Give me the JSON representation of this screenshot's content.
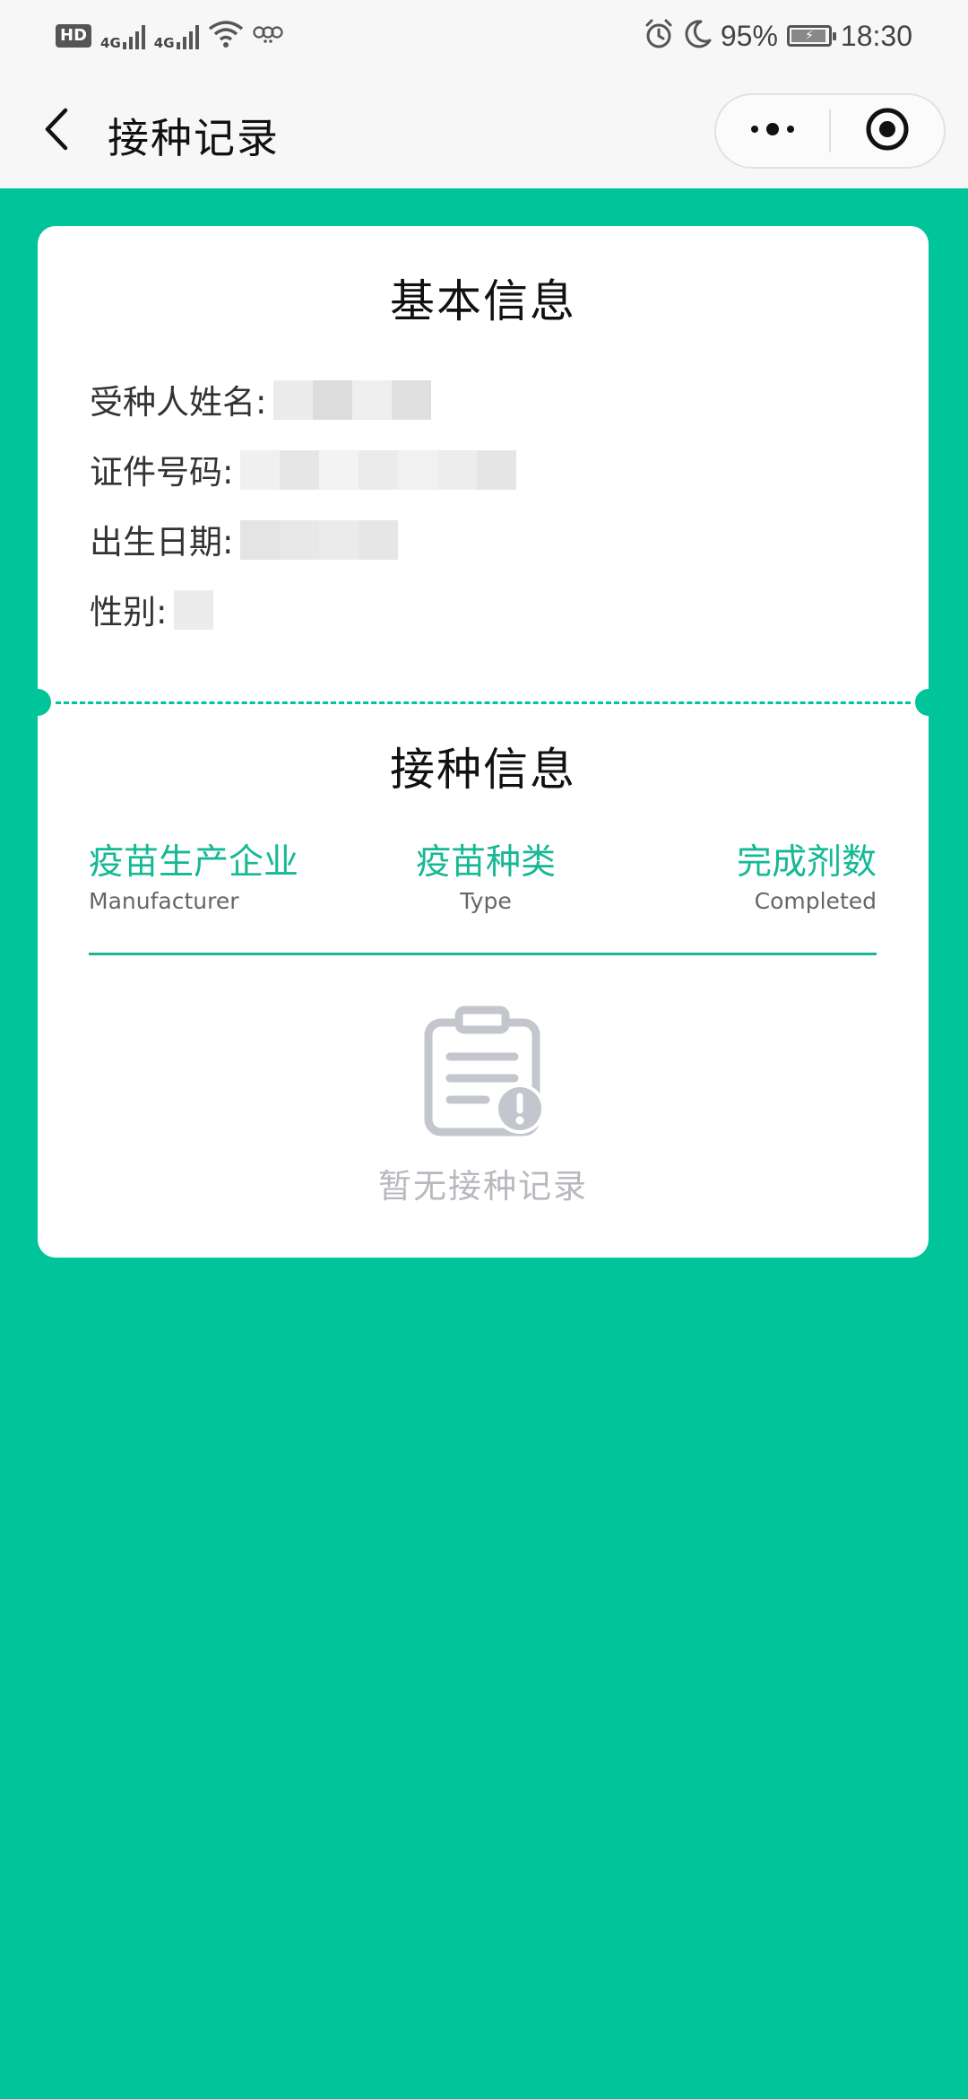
{
  "status_bar": {
    "hd_badge": "HD",
    "sim1_network": "4G",
    "sim2_network": "4G",
    "battery_percent": "95%",
    "time": "18:30"
  },
  "nav": {
    "title": "接种记录"
  },
  "basic_info": {
    "title": "基本信息",
    "fields": [
      {
        "label": "受种人姓名:"
      },
      {
        "label": "证件号码:"
      },
      {
        "label": "出生日期:"
      },
      {
        "label": "性别:"
      }
    ]
  },
  "vaccination_info": {
    "title": "接种信息",
    "columns": [
      {
        "zh": "疫苗生产企业",
        "en": "Manufacturer"
      },
      {
        "zh": "疫苗种类",
        "en": "Type"
      },
      {
        "zh": "完成剂数",
        "en": "Completed"
      }
    ],
    "empty_text": "暂无接种记录"
  },
  "colors": {
    "accent": "#00c49a",
    "header_text": "#16b895",
    "empty_icon": "#c3c6cc"
  },
  "icons": {
    "back": "chevron-left-icon",
    "more": "more-dots-icon",
    "close": "target-circle-icon",
    "empty": "clipboard-warning-icon"
  }
}
